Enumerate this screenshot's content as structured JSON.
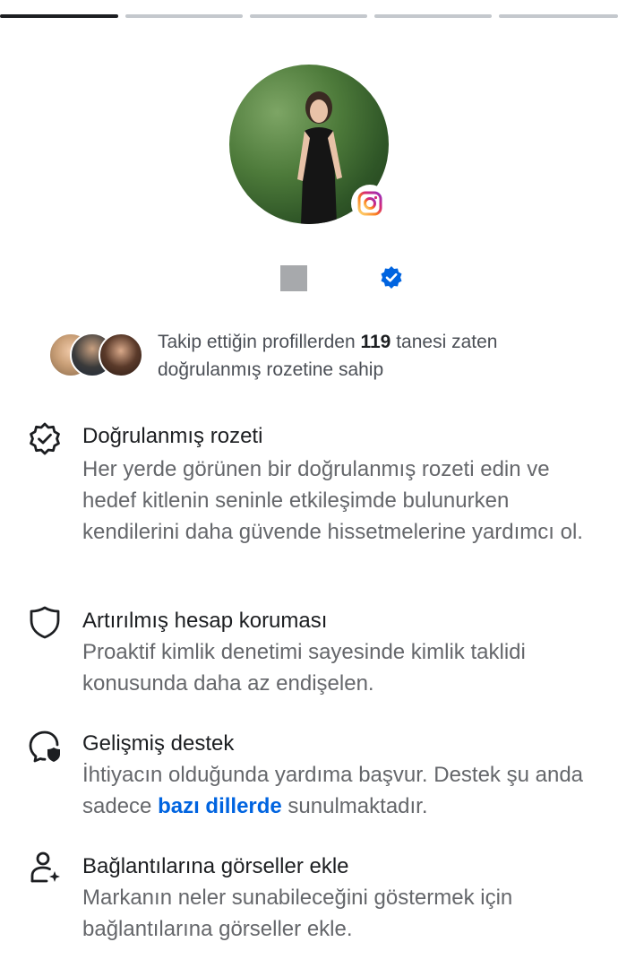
{
  "progress": {
    "segments": 5,
    "active_index": 0
  },
  "profile": {
    "avatar_alt": "profile-photo",
    "platform_badge_icon": "instagram-icon",
    "verified_icon": "verified-badge-icon"
  },
  "mutual": {
    "text_before": "Takip ettiğin profillerden ",
    "count": "119",
    "text_after": " tanesi zaten doğrulanmış rozetine sahip"
  },
  "features": [
    {
      "icon": "verified-badge-outline-icon",
      "title": "Doğrulanmış rozeti",
      "description": "Her yerde görünen bir doğrulanmış rozeti edin ve hedef kitlenin seninle etkileşimde bulunurken kendilerini daha güvende hissetmelerine yardımcı ol."
    },
    {
      "icon": "shield-icon",
      "title": "Artırılmış hesap koruması",
      "description": "Proaktif kimlik denetimi sayesinde kimlik taklidi konusunda daha az endişelen."
    },
    {
      "icon": "support-chat-icon",
      "title": "Gelişmiş destek",
      "description_before": "İhtiyacın olduğunda yardıma başvur. Destek şu anda sadece ",
      "link_text": "bazı dillerde",
      "description_after": " sunulmaktadır."
    },
    {
      "icon": "add-person-icon",
      "title": "Bağlantılarına görseller ekle",
      "description": "Markanın neler sunabileceğini göstermek için bağlantılarına görseller ekle."
    }
  ],
  "colors": {
    "accent_blue": "#0064e0",
    "verified_blue": "#0095f6",
    "text_primary": "#1c1e21",
    "text_secondary": "#65676b"
  }
}
